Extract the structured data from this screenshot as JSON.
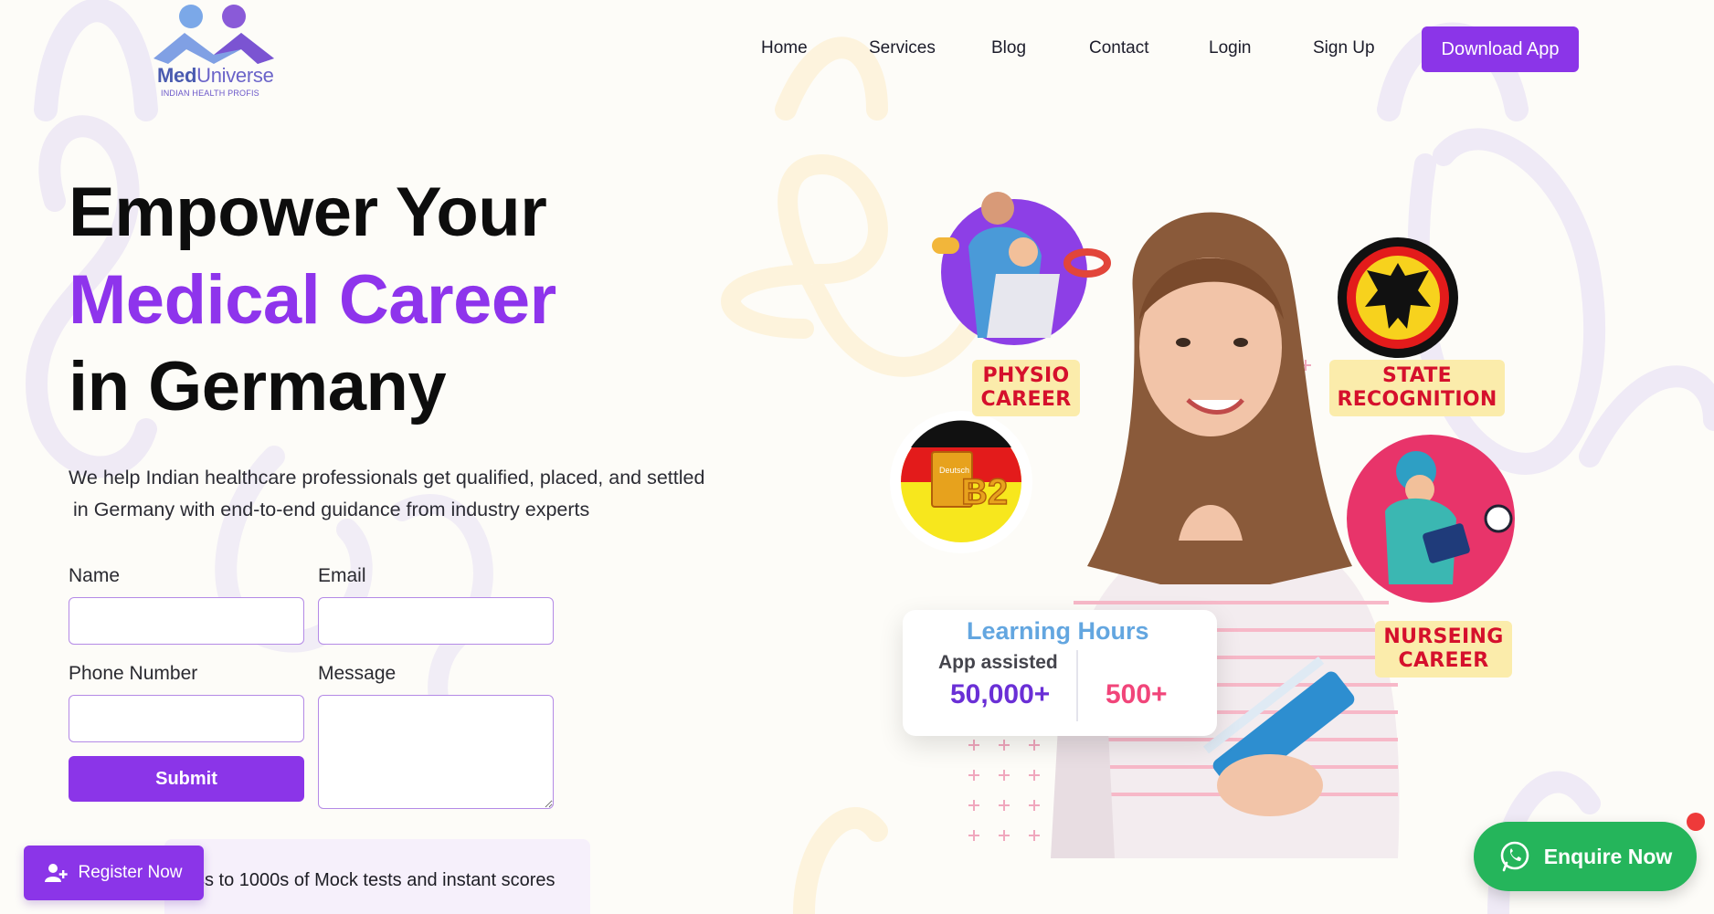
{
  "brand": {
    "name_part1": "Med",
    "name_part2": "Universe",
    "tagline": "INDIAN HEALTH PROFIS"
  },
  "nav": {
    "items": [
      {
        "label": "Home"
      },
      {
        "label": "Services"
      },
      {
        "label": "Blog"
      },
      {
        "label": "Contact"
      },
      {
        "label": "Login"
      },
      {
        "label": "Sign Up"
      }
    ],
    "cta": "Download App"
  },
  "hero": {
    "line1": "Empower Your",
    "line2": "Medical Career",
    "line3": "in Germany",
    "lead_1": "We help Indian healthcare professionals get qualified, placed, and settled",
    "lead_2": "in Germany with end-to-end guidance from industry experts"
  },
  "form": {
    "name_label": "Name",
    "email_label": "Email",
    "phone_label": "Phone Number",
    "message_label": "Message",
    "submit_label": "Submit"
  },
  "register_button": "Register Now",
  "mock_tests_text": "ss to 1000s of Mock tests and instant scores",
  "badges": {
    "physio_1": "PHYSIO",
    "physio_2": "CAREER",
    "state_1": "STATE",
    "state_2": "RECOGNITION",
    "nursing_1": "NURSEING",
    "nursing_2": "CAREER",
    "b2_book_label": "Deutsch",
    "b2_level": "B2"
  },
  "stats": {
    "title": "Learning Hours",
    "subtitle": "App assisted",
    "value_1": "50,000+",
    "value_2": "500+"
  },
  "enquire_button": "Enquire Now",
  "colors": {
    "accent": "#8b35e8",
    "headline_purple": "#8e34ec",
    "whatsapp_green": "#25b55b",
    "badge_red": "#d5102c"
  }
}
